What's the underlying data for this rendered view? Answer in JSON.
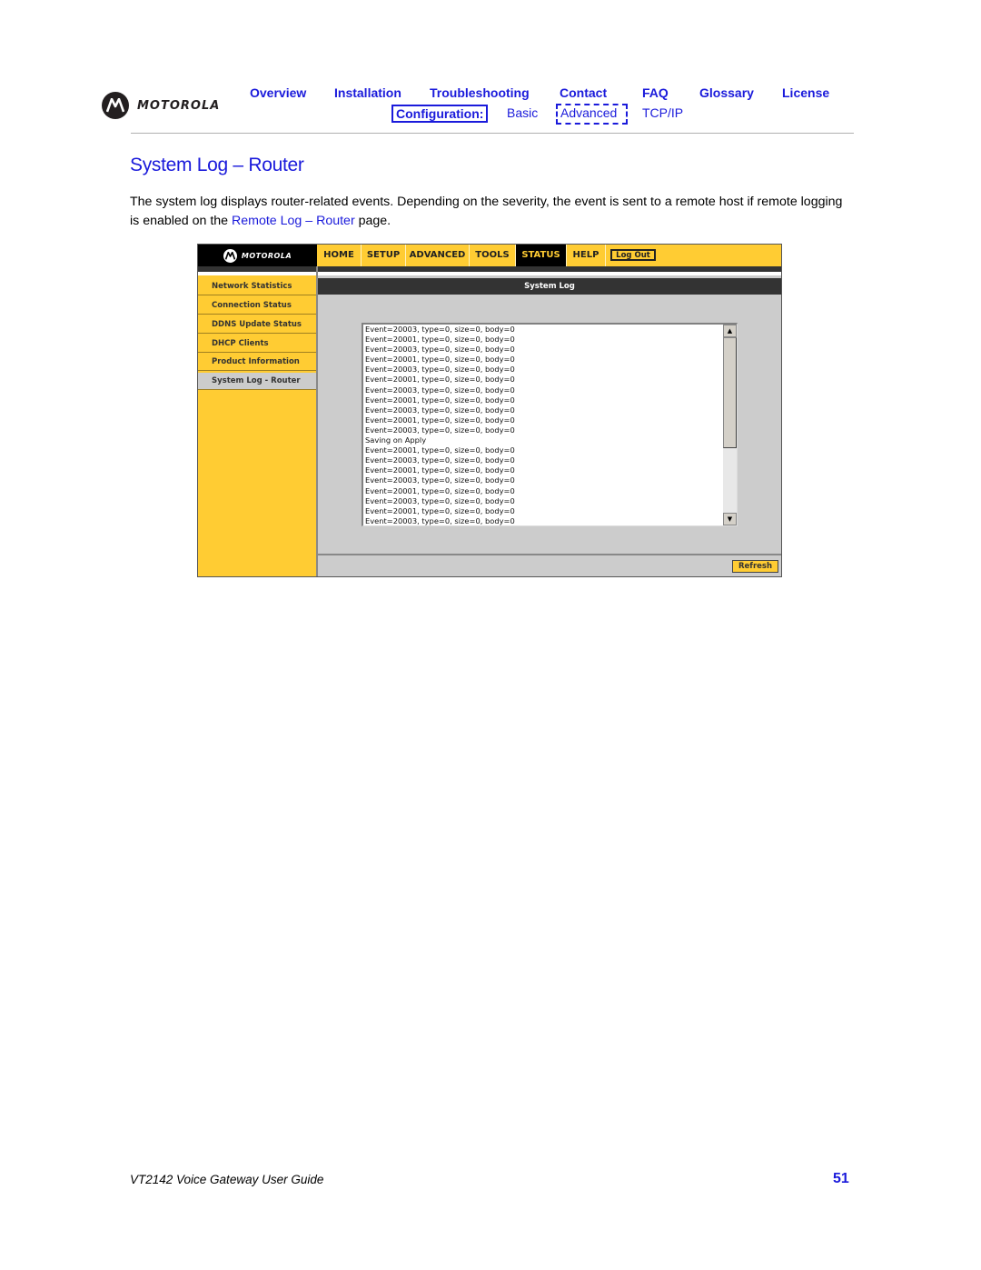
{
  "header": {
    "brand": "MOTOROLA",
    "nav": [
      "Overview",
      "Installation",
      "Troubleshooting",
      "Contact",
      "FAQ",
      "Glossary",
      "License"
    ],
    "config_label": "Configuration:",
    "config_links": [
      "Basic",
      "Advanced",
      "TCP/IP"
    ],
    "config_selected": "Advanced"
  },
  "page": {
    "title": "System Log – Router",
    "intro_text": "The system log displays router-related events. Depending on the severity, the event is sent to a remote host if remote logging is enabled on the ",
    "intro_link": "Remote Log – Router",
    "intro_tail": " page."
  },
  "screenshot": {
    "brand": "MOTOROLA",
    "tabs": [
      "HOME",
      "SETUP",
      "ADVANCED",
      "TOOLS",
      "STATUS",
      "HELP"
    ],
    "active_tab": "STATUS",
    "logout_label": "Log Out",
    "sidebar": [
      "Network Statistics",
      "Connection Status",
      "DDNS Update Status",
      "DHCP Clients",
      "Product Information",
      "System Log - Router"
    ],
    "active_sidebar": "System Log - Router",
    "panel_title": "System Log",
    "log_lines": [
      "Event=20003, type=0, size=0, body=0",
      "Event=20001, type=0, size=0, body=0",
      "Event=20003, type=0, size=0, body=0",
      "Event=20001, type=0, size=0, body=0",
      "Event=20003, type=0, size=0, body=0",
      "Event=20001, type=0, size=0, body=0",
      "Event=20003, type=0, size=0, body=0",
      "Event=20001, type=0, size=0, body=0",
      "Event=20003, type=0, size=0, body=0",
      "Event=20001, type=0, size=0, body=0",
      "Event=20003, type=0, size=0, body=0",
      "Saving on Apply",
      "Event=20001, type=0, size=0, body=0",
      "Event=20003, type=0, size=0, body=0",
      "Event=20001, type=0, size=0, body=0",
      "Event=20003, type=0, size=0, body=0",
      "Event=20001, type=0, size=0, body=0",
      "Event=20003, type=0, size=0, body=0",
      "Event=20001, type=0, size=0, body=0",
      "Event=20003, type=0, size=0, body=0"
    ],
    "refresh_label": "Refresh"
  },
  "footer": {
    "guide_title": "VT2142 Voice Gateway User Guide",
    "page_number": "51"
  },
  "colors": {
    "link_blue": "#1a1adb",
    "router_yellow": "#ffcc33"
  }
}
